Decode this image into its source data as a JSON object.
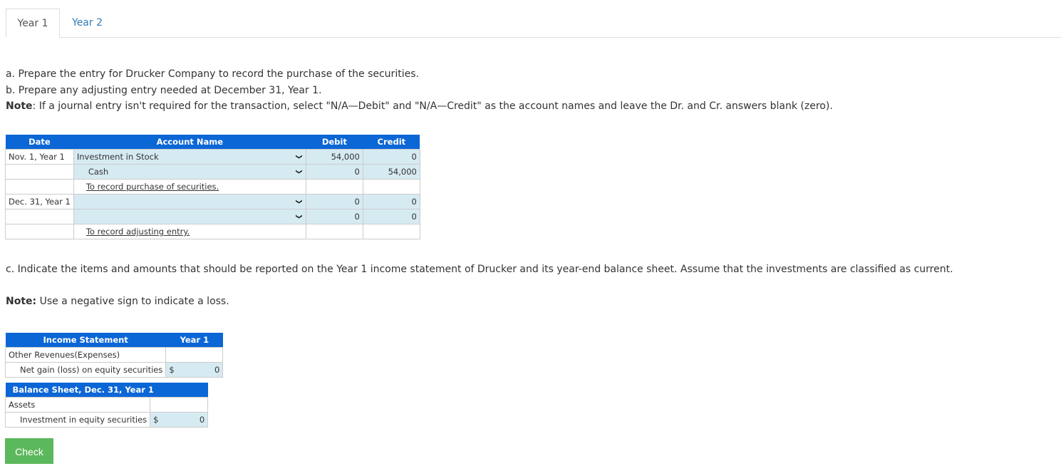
{
  "tabs": [
    {
      "label": "Year 1",
      "active": true
    },
    {
      "label": "Year 2",
      "active": false
    }
  ],
  "instructions": {
    "a": "a. Prepare the entry for Drucker Company to record the purchase of the securities.",
    "b": "b. Prepare any adjusting entry needed at December 31, Year 1.",
    "note_label": "Note",
    "note_text": ": If a journal entry isn't required for the transaction, select \"N/A—Debit\" and \"N/A—Credit\" as the account names and leave the Dr. and Cr. answers blank (zero)."
  },
  "journal": {
    "headers": {
      "date": "Date",
      "account": "Account Name",
      "debit": "Debit",
      "credit": "Credit"
    },
    "rows": [
      {
        "date": "Nov. 1, Year 1",
        "account": "Investment in Stock",
        "debit": "54,000",
        "credit": "0"
      },
      {
        "date": "",
        "account": "Cash",
        "debit": "0",
        "credit": "54,000"
      },
      {
        "date": "",
        "memo": "To record purchase of securities."
      },
      {
        "date": "Dec. 31, Year 1",
        "account": "",
        "debit": "0",
        "credit": "0"
      },
      {
        "date": "",
        "account": "",
        "debit": "0",
        "credit": "0"
      },
      {
        "date": "",
        "memo": "To record adjusting entry."
      }
    ]
  },
  "part_c": {
    "text": "c. Indicate the items and amounts that should be reported on the Year 1 income statement of Drucker and its year-end balance sheet. Assume that the investments are classified as current.",
    "note_label": "Note:",
    "note_text": " Use a negative sign to indicate a loss."
  },
  "income_statement": {
    "header": "Income Statement",
    "col": "Year 1",
    "section": "Other Revenues(Expenses)",
    "item": "Net gain (loss) on equity securities",
    "currency": "$",
    "value": "0"
  },
  "balance_sheet": {
    "header": "Balance Sheet, Dec. 31, Year 1",
    "section": "Assets",
    "item": "Investment in equity securities",
    "currency": "$",
    "value": "0"
  },
  "check_label": "Check"
}
